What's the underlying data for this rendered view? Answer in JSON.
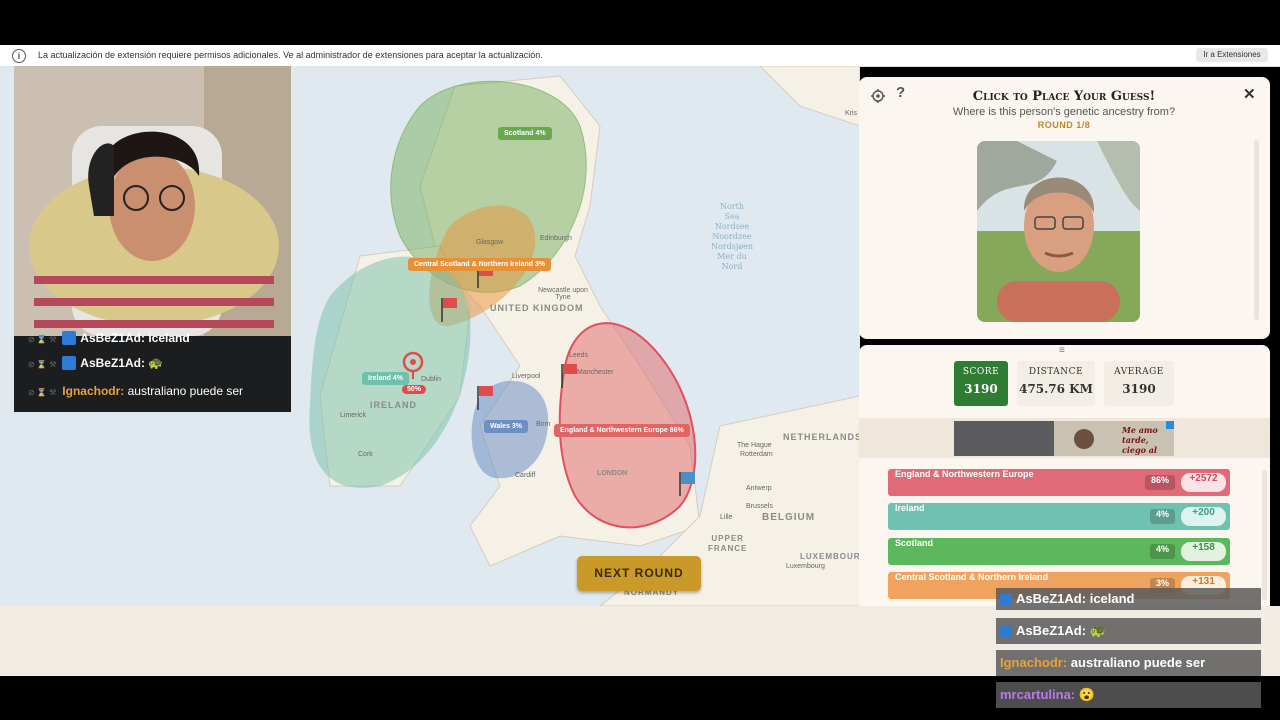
{
  "infobar": {
    "icon": "info-icon",
    "message": "La actualización de extensión requiere permisos adicionales. Ve al administrador de extensiones para aceptar la actualización.",
    "button": "Ir a Extensiones"
  },
  "map": {
    "regions": [
      {
        "label": "Scotland 4%",
        "color": "#6aa84f"
      },
      {
        "label": "Central Scotland & Northern Ireland 3%",
        "color": "#e69138"
      },
      {
        "label": "Ireland 4%",
        "color": "#76c0a8"
      },
      {
        "label": "Wales 3%",
        "color": "#6d8fc4"
      },
      {
        "label": "England & Northwestern Europe 86%",
        "color": "#e06666"
      }
    ],
    "guess_badge": "50%",
    "places": {
      "glasgow": "Glasgow",
      "edinburgh": "Edinburgh",
      "newcastle": "Newcastle upon Tyne",
      "liverpool": "Liverpool",
      "leeds": "Leeds",
      "manchester": "Manchester",
      "dublin": "Dublin",
      "limerick": "Limerick",
      "cork": "Cork",
      "cardiff": "Cardiff",
      "birmingham": "Birm",
      "london": "LONDON",
      "the_hague": "The Hague",
      "rotterdam": "Rotterdam",
      "antwerp": "Antwerp",
      "brussels": "Brussels",
      "lille": "Lille",
      "luxembourg": "Luxembourg",
      "normandy": "NORMANDY",
      "kristiansand": "Kris"
    },
    "countries": {
      "uk": "UNITED KINGDOM",
      "ireland": "IRELAND",
      "netherlands": "NETHERLANDS",
      "belgium": "BELGIUM",
      "upper_france": "UPPER\nFRANCE",
      "luxembourg": "LUXEMBOURG"
    },
    "north_sea": "North\nSea\nNordsee\nNoordzee\nNordsjøen\nMer du\nNord",
    "next_round": "NEXT ROUND"
  },
  "chat_left": [
    {
      "user": "AsBeZ1Ad:",
      "message": "iceland"
    },
    {
      "user": "AsBeZ1Ad:",
      "message": "🐢"
    },
    {
      "user": "Ignachodr:",
      "message": "australiano puede ser"
    }
  ],
  "panel": {
    "title": "Click to Place Your Guess!",
    "subtitle": "Where is this person's genetic ancestry from?",
    "round": "ROUND 1/8",
    "stats": {
      "score_label": "SCORE",
      "score": "3190",
      "distance_label": "DISTANCE",
      "distance": "475.76 KM",
      "average_label": "AVERAGE",
      "average": "3190"
    },
    "ad_text": "Me amo tarde, ciego al mejor.",
    "results": [
      {
        "name": "England & Northwestern Europe",
        "pct": "86%",
        "score": "+2572",
        "color": "#e06a78"
      },
      {
        "name": "Ireland",
        "pct": "4%",
        "score": "+200",
        "color": "#6fc1b0"
      },
      {
        "name": "Scotland",
        "pct": "4%",
        "score": "+158",
        "color": "#5cb85c"
      },
      {
        "name": "Central Scotland & Northern Ireland",
        "pct": "3%",
        "score": "+131",
        "color": "#f0a35e"
      }
    ]
  },
  "chat_right": [
    {
      "user": "AsBeZ1Ad:",
      "message": "iceland",
      "color": "#ffffff"
    },
    {
      "user": "AsBeZ1Ad:",
      "message": "🐢",
      "color": "#ffffff"
    },
    {
      "user": "Ignachodr:",
      "message": "australiano puede ser",
      "color": "#e8a23a"
    },
    {
      "user": "mrcartulina:",
      "message": "😮",
      "color": "#b77be8"
    }
  ]
}
